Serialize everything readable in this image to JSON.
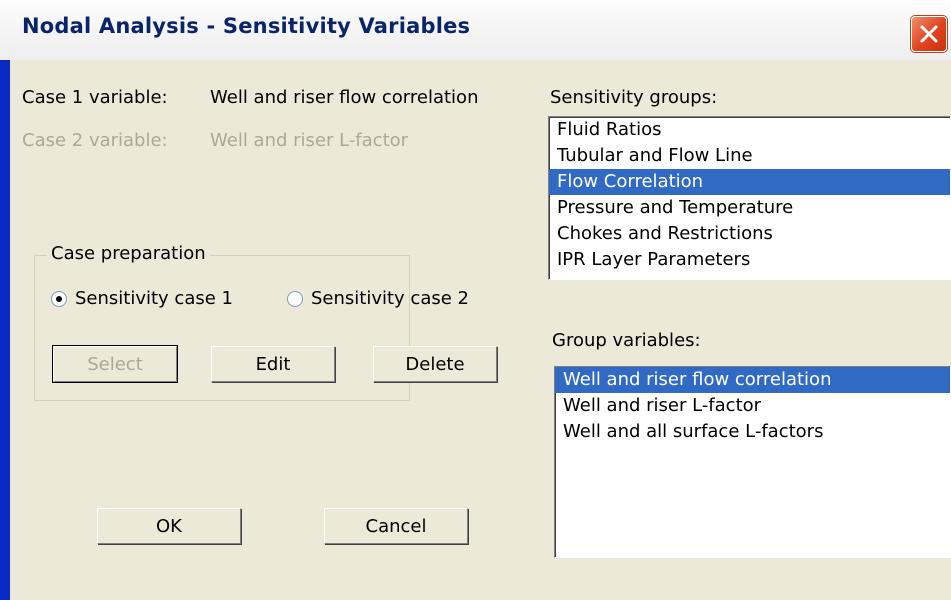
{
  "window": {
    "title": "Nodal Analysis - Sensitivity Variables"
  },
  "case1": {
    "label": "Case 1 variable:",
    "value": "Well and riser flow correlation"
  },
  "case2": {
    "label": "Case 2 variable:",
    "value": "Well and riser L-factor"
  },
  "case_preparation": {
    "label": "Case preparation",
    "radio1_label": "Sensitivity case 1",
    "radio2_label": "Sensitivity case 2",
    "selected_radio": 1,
    "select_label": "Select",
    "edit_label": "Edit",
    "delete_label": "Delete"
  },
  "buttons": {
    "ok": "OK",
    "cancel": "Cancel"
  },
  "sensitivity_groups": {
    "label": "Sensitivity groups:",
    "items": [
      "Fluid Ratios",
      "Tubular and Flow Line",
      "Flow Correlation",
      "Pressure and Temperature",
      "Chokes and Restrictions",
      "IPR Layer Parameters"
    ],
    "selected": "Flow Correlation"
  },
  "group_variables": {
    "label": "Group variables:",
    "items": [
      "Well and riser flow correlation",
      "Well and riser L-factor",
      "Well and all surface L-factors"
    ],
    "selected": "Well and riser flow correlation"
  },
  "colors": {
    "title_text": "#0a246a",
    "selection": "#316ac5",
    "dialog_bg": "#ece9d8",
    "close_button": "#e0421d"
  },
  "icons": {
    "close": "close-x-icon",
    "radio": "radio-dot-icon"
  }
}
